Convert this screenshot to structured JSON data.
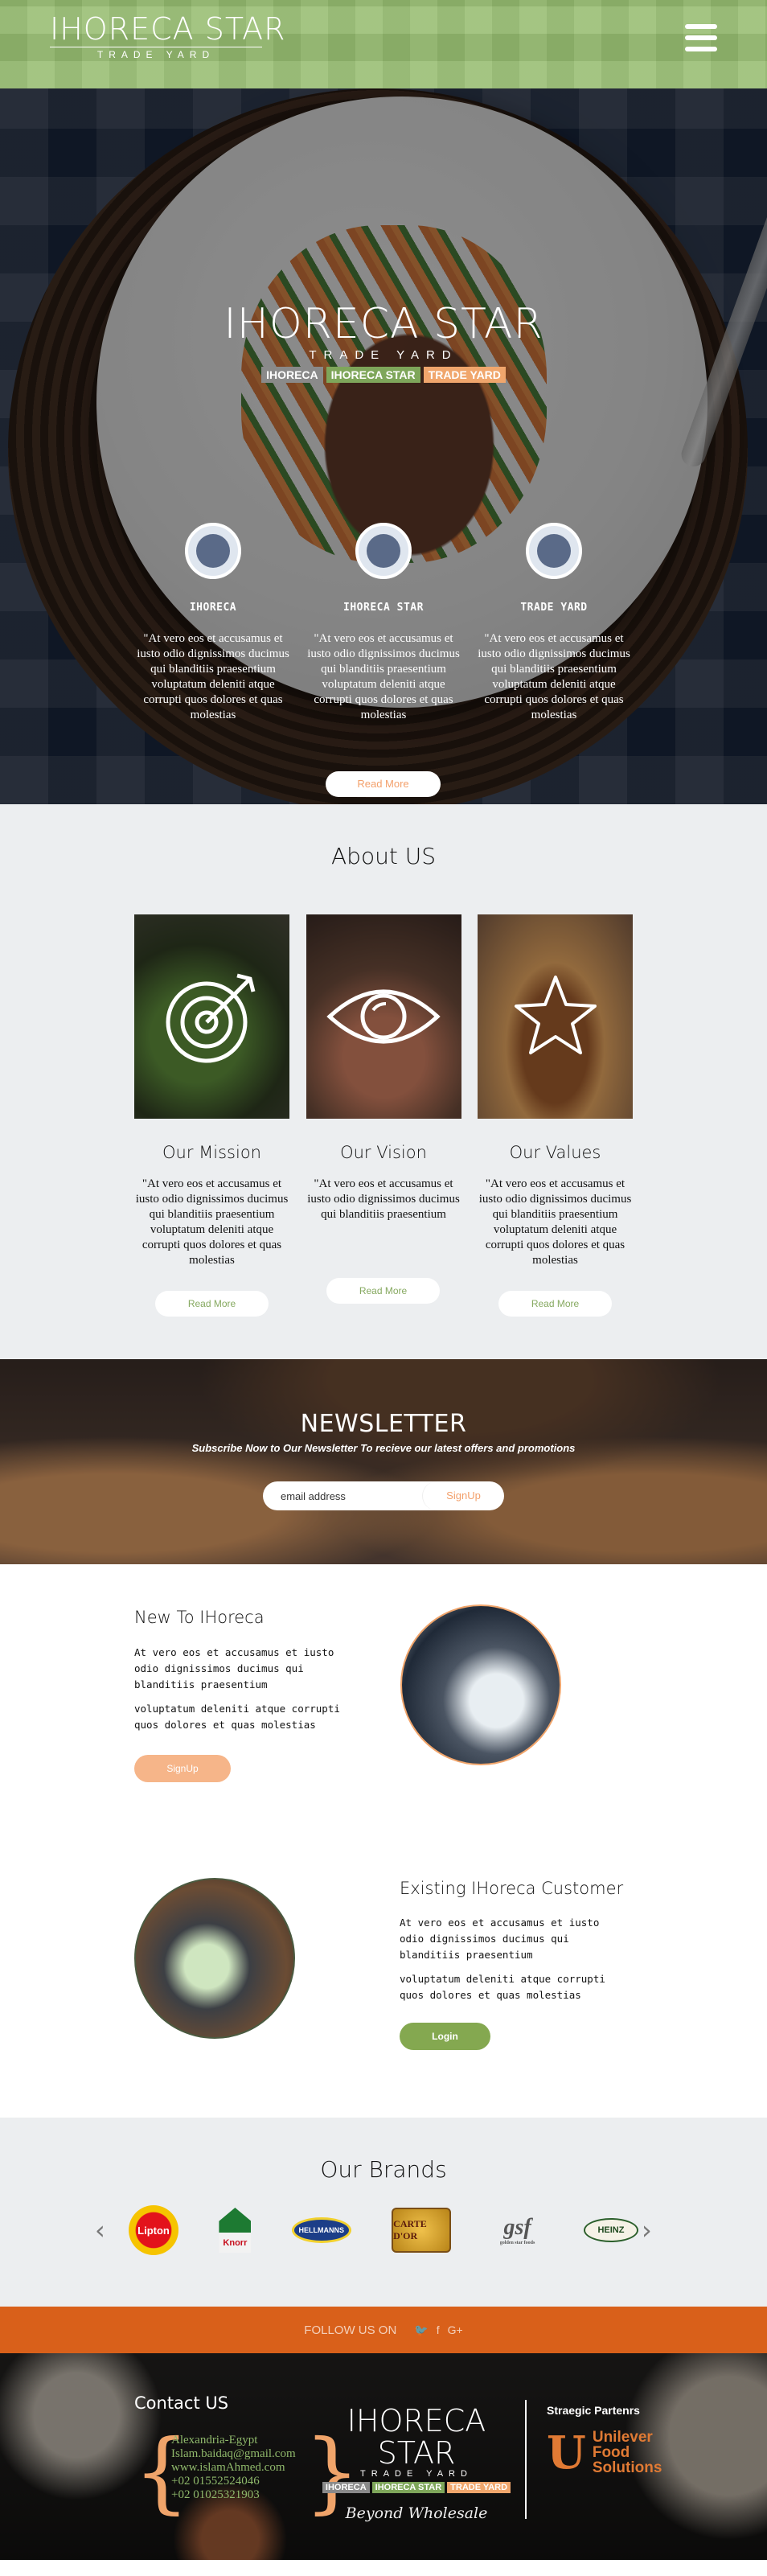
{
  "header": {
    "logo_main": "IHORECA STAR",
    "logo_sub": "TRADE YARD"
  },
  "hero": {
    "logo_main": "IHORECA STAR",
    "logo_sub": "TRADE YARD",
    "chips": [
      "IHORECA",
      "IHORECA STAR",
      "TRADE YARD"
    ],
    "columns": [
      {
        "name": "IHORECA",
        "text": "\"At vero eos et accusamus et iusto odio dignissimos ducimus qui blanditiis praesentium voluptatum deleniti atque corrupti quos dolores et quas molestias"
      },
      {
        "name": "IHORECA STAR",
        "text": "\"At vero eos et accusamus et iusto odio dignissimos ducimus qui blanditiis praesentium voluptatum deleniti atque corrupti quos dolores et quas molestias"
      },
      {
        "name": "TRADE YARD",
        "text": "\"At vero eos et accusamus et iusto odio dignissimos ducimus qui blanditiis praesentium voluptatum deleniti atque corrupti quos dolores et quas molestias"
      }
    ],
    "read_more": "Read More"
  },
  "about": {
    "title": "About US",
    "cards": [
      {
        "title": "Our Mission",
        "text": "\"At vero eos et accusamus et iusto odio dignissimos ducimus qui blanditiis praesentium voluptatum deleniti atque corrupti quos dolores et quas molestias",
        "button": "Read More"
      },
      {
        "title": "Our Vision",
        "text": "\"At vero eos et accusamus et iusto odio dignissimos ducimus qui blanditiis praesentium",
        "button": "Read More"
      },
      {
        "title": "Our Values",
        "text": "\"At vero eos et accusamus et iusto odio dignissimos ducimus qui blanditiis praesentium voluptatum deleniti atque corrupti quos dolores et quas molestias",
        "button": "Read More"
      }
    ]
  },
  "newsletter": {
    "title": "NEWSLETTER",
    "subtitle": "Subscribe Now to Our Newsletter To recieve our latest offers and promotions",
    "placeholder": "email address",
    "button": "SignUp"
  },
  "new_customer": {
    "title": "New To IHoreca",
    "para1": "At vero eos et accusamus et iusto odio dignissimos ducimus qui blanditiis praesentium",
    "para2": "voluptatum deleniti atque corrupti quos dolores et quas molestias",
    "button": "SignUp"
  },
  "existing_customer": {
    "title": "Existing IHoreca Customer",
    "para1": "At vero eos et accusamus et iusto odio dignissimos ducimus qui blanditiis praesentium",
    "para2": "voluptatum deleniti atque corrupti quos dolores et quas molestias",
    "button": "Login"
  },
  "brands": {
    "title": "Our Brands",
    "items": [
      "Lipton",
      "Knorr",
      "HELLMANNS",
      "CARTE D'OR",
      "gsf",
      "HEINZ"
    ],
    "gsf_sub": "golden star foods",
    "prev": "‹",
    "next": "›"
  },
  "follow": {
    "label": "FOLLOW US ON",
    "icons": [
      "twitter-icon",
      "facebook-icon",
      "google-plus-icon"
    ],
    "glyphs": [
      "🐦",
      "f",
      "G+"
    ]
  },
  "footer": {
    "contact_title": "Contact US",
    "contact_lines": [
      "Alexandria-Egypt",
      "Islam.baidaq@gmail.com",
      "www.islamAhmed.com",
      "+02 01552524046",
      "+02 01025321903"
    ],
    "logo_main": "IHORECA STAR",
    "logo_sub": "TRADE YARD",
    "chips": [
      "IHORECA",
      "IHORECA STAR",
      "TRADE YARD"
    ],
    "tagline": "Beyond Wholesale",
    "partners_title": "Straegic Partenrs",
    "partner_lines": [
      "Unilever",
      "Food",
      "Solutions"
    ]
  },
  "colors": {
    "green": "#84a850",
    "orange": "#d9601a",
    "peach": "#f3a06b"
  }
}
